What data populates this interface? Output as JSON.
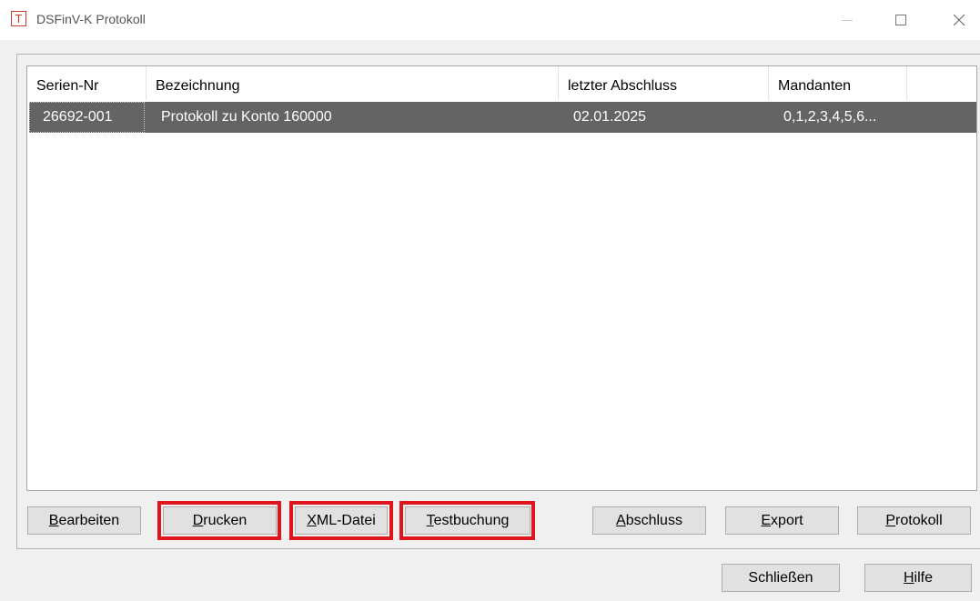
{
  "window": {
    "icon_letter": "T",
    "title": "DSFinV-K Protokoll"
  },
  "table": {
    "columns": [
      "Serien-Nr",
      "Bezeichnung",
      "letzter Abschluss",
      "Mandanten"
    ],
    "rows": [
      {
        "serien_nr": "26692-001",
        "bezeichnung": "Protokoll zu Konto 160000",
        "letzter_abschluss": "02.01.2025",
        "mandanten": "0,1,2,3,4,5,6..."
      }
    ]
  },
  "buttons": {
    "bearbeiten": {
      "mnemonic": "B",
      "rest": "earbeiten"
    },
    "drucken": {
      "mnemonic": "D",
      "rest": "rucken"
    },
    "xml_datei": {
      "mnemonic": "X",
      "rest": "ML-Datei"
    },
    "testbuchung": {
      "mnemonic": "T",
      "rest": "estbuchung"
    },
    "abschluss": {
      "mnemonic": "A",
      "rest": "bschluss"
    },
    "export": {
      "mnemonic": "E",
      "rest": "xport"
    },
    "protokoll": {
      "mnemonic": "P",
      "rest": "rotokoll"
    },
    "schliessen": "Schließen",
    "hilfe": {
      "mnemonic": "H",
      "rest": "ilfe"
    }
  },
  "colors": {
    "highlight_border": "#e0141c",
    "selected_row": "#646464"
  }
}
